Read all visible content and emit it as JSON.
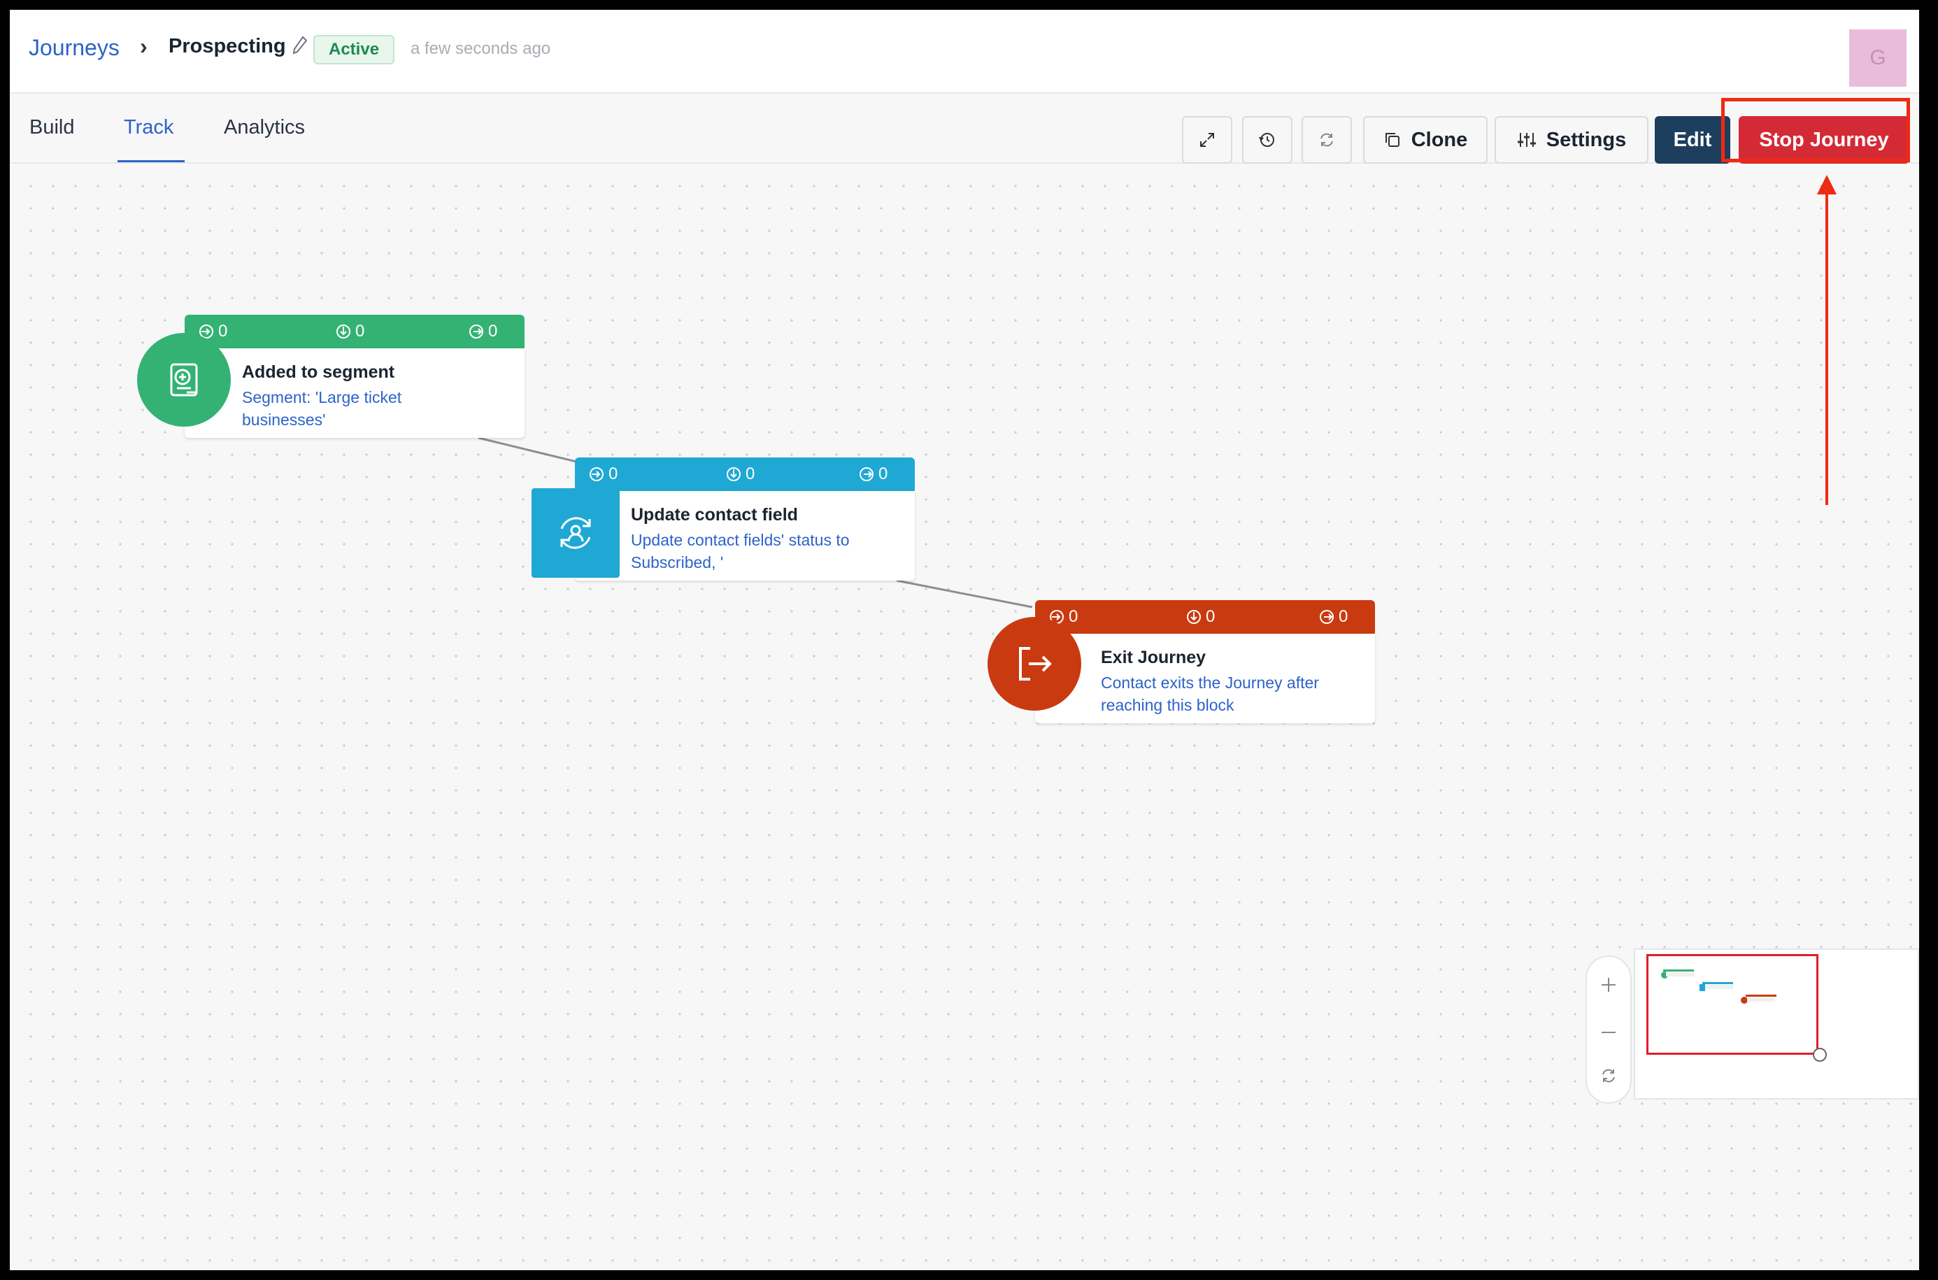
{
  "header": {
    "breadcrumb_root": "Journeys",
    "breadcrumb_separator": "›",
    "journey_name": "Prospecting",
    "status": "Active",
    "last_saved": "a few seconds ago",
    "avatar_initial": "G"
  },
  "tabs": [
    {
      "label": "Build",
      "active": false
    },
    {
      "label": "Track",
      "active": true
    },
    {
      "label": "Analytics",
      "active": false
    }
  ],
  "toolbar": {
    "fullscreen_icon": "expand-icon",
    "history_icon": "history-icon",
    "refresh_icon": "refresh-icon",
    "clone_label": "Clone",
    "settings_label": "Settings",
    "edit_label": "Edit",
    "stop_label": "Stop Journey"
  },
  "nodes": [
    {
      "title": "Added to segment",
      "description": "Segment: 'Large ticket businesses'",
      "desc_line1": "Segment: 'Large ticket",
      "desc_line2": "businesses'",
      "entered": "0",
      "waiting": "0",
      "exited": "0",
      "icon": "segment-add-icon",
      "color": "#34b274"
    },
    {
      "title": "Update contact field",
      "description": "Update contact fields' status to Subscribed, '",
      "desc_line1": "Update contact fields' status to",
      "desc_line2": "Subscribed, '",
      "entered": "0",
      "waiting": "0",
      "exited": "0",
      "icon": "contact-refresh-icon",
      "color": "#1fa8d4"
    },
    {
      "title": "Exit Journey",
      "description": "Contact exits the Journey after reaching this block",
      "desc_line1": "Contact exits the Journey after",
      "desc_line2": "reaching this block",
      "entered": "0",
      "waiting": "0",
      "exited": "0",
      "icon": "exit-icon",
      "color": "#c93a10"
    }
  ],
  "colors": {
    "accent": "#2d63c8",
    "stop": "#d42a36",
    "edit": "#1e3e5e",
    "annotation": "#ee2a12"
  }
}
